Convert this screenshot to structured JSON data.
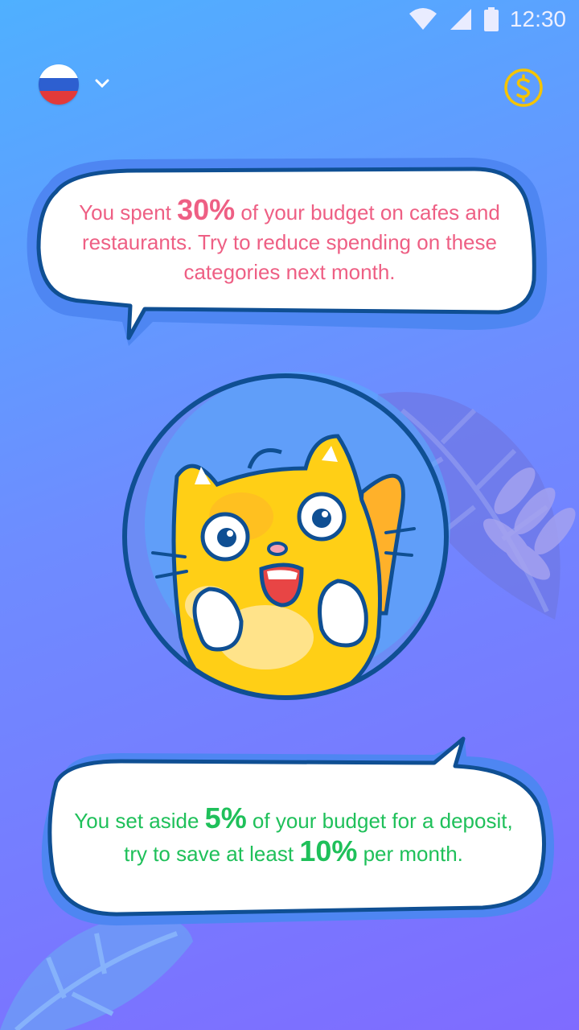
{
  "status_bar": {
    "time": "12:30"
  },
  "header": {
    "language_flag": "russia-flag",
    "language_chevron": "chevron-down-icon",
    "coin_icon": "dollar-coin-icon"
  },
  "messages": [
    {
      "pre": "You spent ",
      "highlight": "30%",
      "post": " of your budget on cafes and restaurants. Try to reduce spending on these categories next month.",
      "color": "#ee5f84"
    },
    {
      "pre": "You set aside ",
      "highlight": "5%",
      "mid": " of your budget for a deposit, try to save at least ",
      "highlight2": "10%",
      "post": " per month.",
      "color": "#1fc05a"
    }
  ],
  "colors": {
    "bubble_outline": "#0f4f93",
    "bubble_fill": "#ffffff",
    "bubble_shadow": "#4e86f2",
    "coin": "#f5c400",
    "cat_body": "#ffcf16"
  }
}
